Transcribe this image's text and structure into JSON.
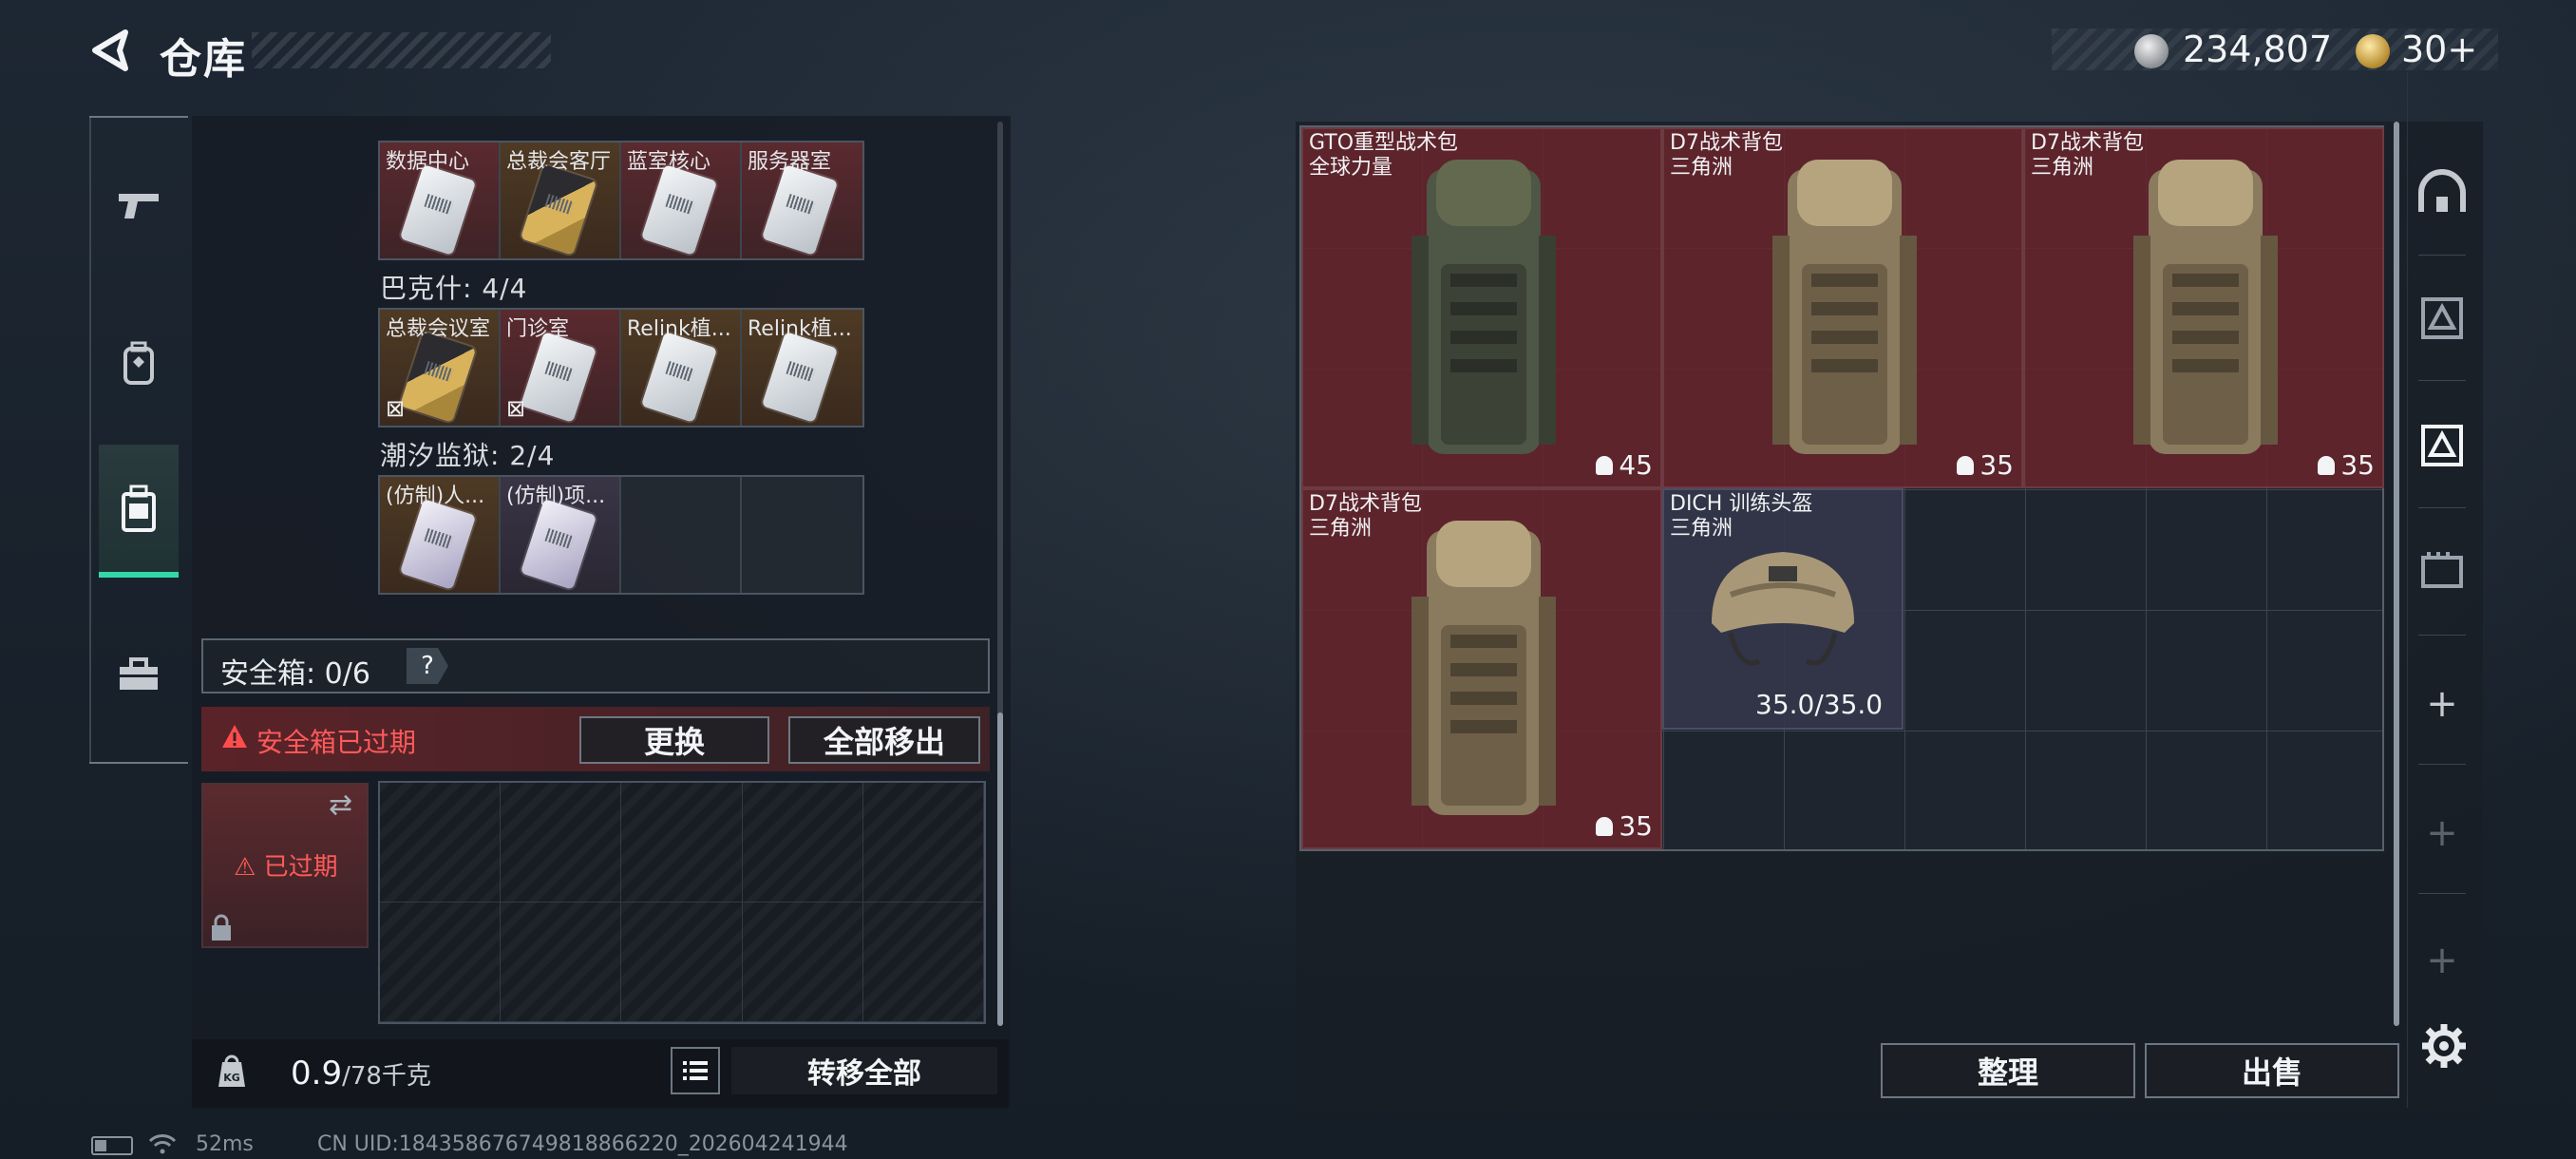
{
  "header": {
    "title": "仓库",
    "currency_silver": "234,807",
    "currency_gold": "30+"
  },
  "left_tabs": [
    {
      "icon": "pistol-icon"
    },
    {
      "icon": "backpack-icon"
    },
    {
      "icon": "storage-case-icon",
      "active": true
    },
    {
      "icon": "toolbox-icon"
    }
  ],
  "keycard_groups": [
    {
      "label": "",
      "cards": [
        {
          "name": "数据中心",
          "style": "white"
        },
        {
          "name": "总裁会客厅",
          "style": "gold"
        },
        {
          "name": "蓝室核心",
          "style": "white"
        },
        {
          "name": "服务器室",
          "style": "white"
        }
      ]
    },
    {
      "label": "巴克什: 4/4",
      "cards": [
        {
          "name": "总裁会议室",
          "style": "gold",
          "nontrade": true
        },
        {
          "name": "门诊室",
          "style": "white",
          "nontrade": true
        },
        {
          "name": "Relink植...",
          "style": "white"
        },
        {
          "name": "Relink植...",
          "style": "white"
        }
      ]
    },
    {
      "label": "潮汐监狱: 2/4",
      "cards": [
        {
          "name": "(仿制)人...",
          "style": "violet"
        },
        {
          "name": "(仿制)项...",
          "style": "violet"
        },
        {
          "name": "",
          "style": "empty"
        },
        {
          "name": "",
          "style": "empty"
        }
      ]
    }
  ],
  "safe_box": {
    "label": "安全箱: 0/6",
    "help": "?",
    "warning": "安全箱已过期",
    "replace_label": "更换",
    "move_all_label": "全部移出",
    "expired_label": "已过期"
  },
  "footer": {
    "weight": "0.9",
    "weight_cap": "/78千克",
    "transfer_label": "转移全部"
  },
  "status_bar": {
    "ping": "52ms",
    "uid": "CN UID:1843586767498188662​20_202604241944"
  },
  "storage_items": [
    {
      "title": "GTO重型战术包",
      "subtitle": "全球力量",
      "capacity": "45",
      "type": "backpack-green"
    },
    {
      "title": "D7战术背包",
      "subtitle": "三角洲",
      "capacity": "35",
      "type": "backpack-tan"
    },
    {
      "title": "D7战术背包",
      "subtitle": "三角洲",
      "capacity": "35",
      "type": "backpack-tan"
    },
    {
      "title": "D7战术背包",
      "subtitle": "三角洲",
      "capacity": "35",
      "type": "backpack-tan"
    },
    {
      "title": "DICH 训练头盔",
      "subtitle": "三角洲",
      "durability": "35.0/35.0",
      "type": "helmet"
    }
  ],
  "right_rail": [
    "helmet-rail-icon",
    "armor-rail-icon",
    "chest-rig-rail-icon",
    "backpack-rail-icon",
    "plus-icon",
    "plus-icon",
    "plus-icon"
  ],
  "actions": {
    "sort_label": "整理",
    "sell_label": "出售"
  }
}
